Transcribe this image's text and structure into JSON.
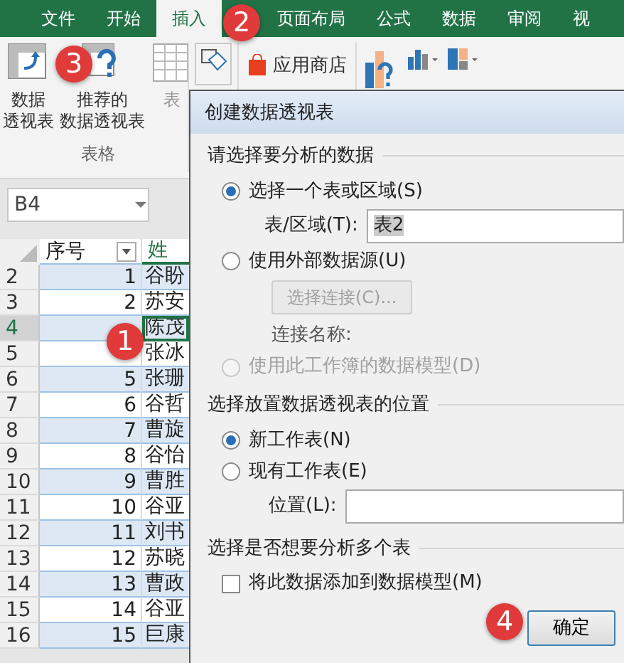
{
  "ribbon_tabs": [
    {
      "label": "文件",
      "selected": false
    },
    {
      "label": "开始",
      "selected": false
    },
    {
      "label": "插入",
      "selected": true
    },
    {
      "label": "页面布局",
      "selected": false
    },
    {
      "label": "公式",
      "selected": false
    },
    {
      "label": "数据",
      "selected": false
    },
    {
      "label": "审阅",
      "selected": false
    },
    {
      "label": "视",
      "selected": false
    }
  ],
  "ribbon": {
    "table_group": {
      "buttons": [
        {
          "kind": "pivot",
          "label_lines": [
            "数据",
            "透视表"
          ]
        },
        {
          "kind": "recommended",
          "label_lines": [
            "推荐的",
            "数据透视表"
          ]
        },
        {
          "kind": "table",
          "label_lines": [
            "表"
          ]
        }
      ],
      "group_label": "表格"
    },
    "app_store": "应用商店"
  },
  "name_box": "B4",
  "sheet": {
    "columns": [
      "序号",
      "姓"
    ],
    "rows": [
      {
        "row": "2",
        "number": "1",
        "name": "谷盼",
        "selected": false
      },
      {
        "row": "3",
        "number": "2",
        "name": "苏安",
        "selected": false
      },
      {
        "row": "4",
        "name": "陈茂",
        "selected": true
      },
      {
        "row": "5",
        "name": "张冰",
        "selected": false
      },
      {
        "row": "6",
        "number": "5",
        "name": "张珊",
        "selected": false
      },
      {
        "row": "7",
        "number": "6",
        "name": "谷哲",
        "selected": false
      },
      {
        "row": "8",
        "number": "7",
        "name": "曹旋",
        "selected": false
      },
      {
        "row": "9",
        "number": "8",
        "name": "谷怡",
        "selected": false
      },
      {
        "row": "10",
        "number": "9",
        "name": "曹胜",
        "selected": false
      },
      {
        "row": "11",
        "number": "10",
        "name": "谷亚",
        "selected": false
      },
      {
        "row": "12",
        "number": "11",
        "name": "刘书",
        "selected": false
      },
      {
        "row": "13",
        "number": "12",
        "name": "苏晓",
        "selected": false
      },
      {
        "row": "14",
        "number": "13",
        "name": "曹政",
        "selected": false
      },
      {
        "row": "15",
        "number": "14",
        "name": "谷亚",
        "selected": false
      },
      {
        "row": "16",
        "number": "15",
        "name": "巨康",
        "selected": false
      }
    ]
  },
  "dialog": {
    "title": "创建数据透视表",
    "sections": [
      {
        "heading": "请选择要分析的数据",
        "items": [
          {
            "kind": "radio",
            "label": "选择一个表或区域(S)",
            "selected": true,
            "disabled": false
          },
          {
            "kind": "field",
            "label": "表/区域(T):",
            "value": "表2"
          },
          {
            "kind": "radio",
            "label": "使用外部数据源(U)",
            "selected": false,
            "disabled": false
          },
          {
            "kind": "button",
            "label": "选择连接(C)...",
            "disabled": true
          },
          {
            "kind": "note",
            "label": "连接名称:"
          },
          {
            "kind": "radio",
            "label": "使用此工作簿的数据模型(D)",
            "selected": false,
            "disabled": true
          }
        ]
      },
      {
        "heading": "选择放置数据透视表的位置",
        "items": [
          {
            "kind": "radio",
            "label": "新工作表(N)",
            "selected": true,
            "disabled": false
          },
          {
            "kind": "radio",
            "label": "现有工作表(E)",
            "selected": false,
            "disabled": false
          },
          {
            "kind": "field",
            "label": "位置(L):"
          }
        ]
      },
      {
        "heading": "选择是否想要分析多个表",
        "items": [
          {
            "kind": "checkbox",
            "label": "将此数据添加到数据模型(M)",
            "checked": false
          }
        ]
      }
    ],
    "ok_button": "确定"
  },
  "markers": [
    "1",
    "2",
    "3",
    "4"
  ]
}
